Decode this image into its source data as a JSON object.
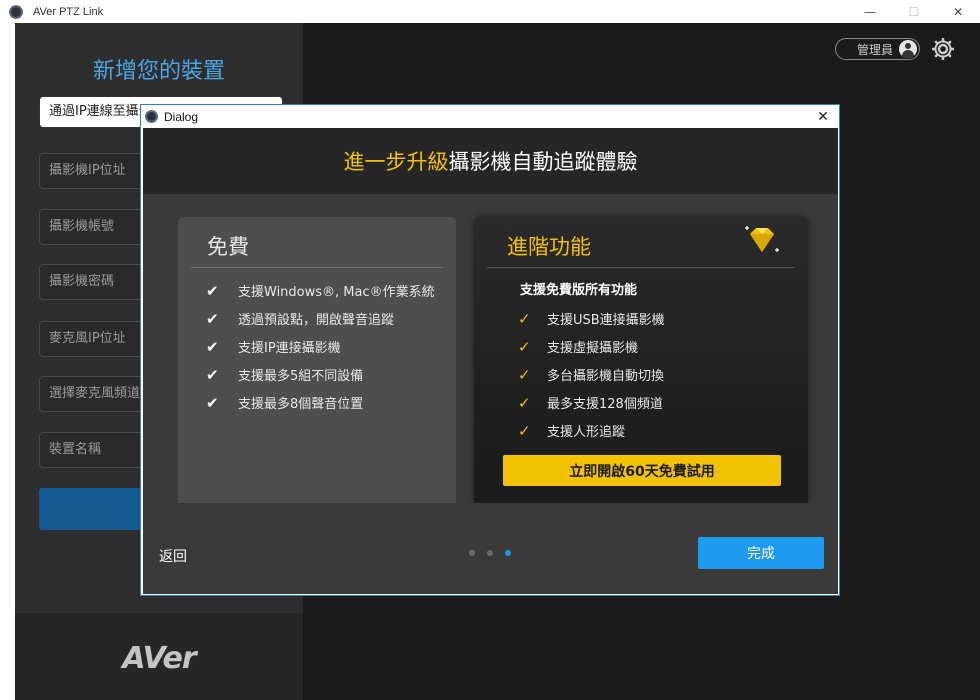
{
  "window": {
    "title": "AVer PTZ Link",
    "minimize": "—",
    "maximize": "☐",
    "close": "✕"
  },
  "sidebar": {
    "title": "新增您的裝置",
    "fields": [
      "通過IP連線至攝影機",
      "攝影機IP位址",
      "攝影機帳號",
      "攝影機密碼",
      "麥克風IP位址",
      "選擇麥克風頻道",
      "裝置名稱"
    ],
    "logo": "AVer"
  },
  "header": {
    "admin_label": "管理員",
    "user_icon": "user-circle-icon",
    "settings_icon": "gear-icon"
  },
  "dialog": {
    "title": "Dialog",
    "close": "✕",
    "heading_accent": "進一步升級",
    "heading_rest": "攝影機自動追蹤體驗",
    "free": {
      "title": "免費",
      "features": [
        "支援Windows®, Mac®作業系統",
        "透過預設點，開啟聲音追蹤",
        "支援IP連接攝影機",
        "支援最多5組不同設備",
        "支援最多8個聲音位置"
      ]
    },
    "pro": {
      "title": "進階功能",
      "subtitle": "支援免費版所有功能",
      "features": [
        "支援USB連接攝影機",
        "支援虛擬攝影機",
        "多台攝影機自動切換",
        "最多支援128個頻道",
        "支援人形追蹤"
      ],
      "trial_button": "立即開啟60天免費試用"
    },
    "back": "返回",
    "pagination": {
      "total": 3,
      "current": 3
    },
    "done": "完成"
  },
  "colors": {
    "accent_gold": "#f2c200",
    "accent_blue": "#1c9bf0",
    "sidebar_title": "#4aa6e6"
  }
}
